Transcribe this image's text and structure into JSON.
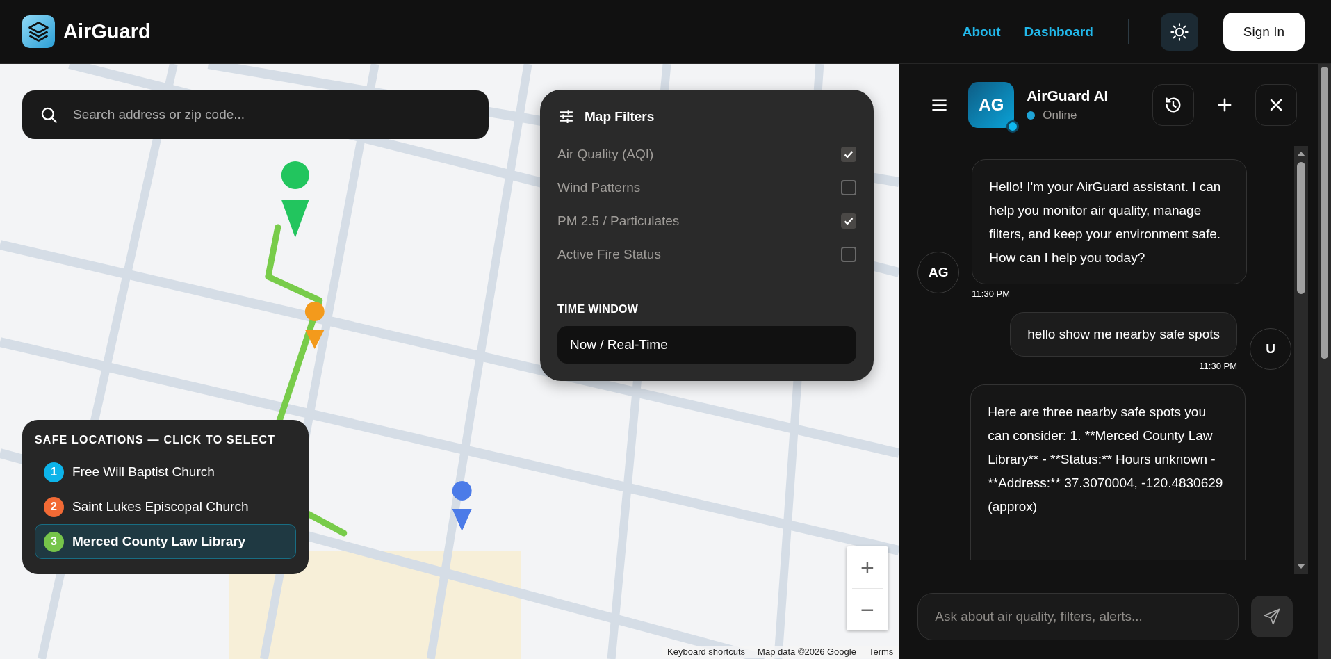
{
  "header": {
    "brand": "AirGuard",
    "nav": [
      {
        "label": "About"
      },
      {
        "label": "Dashboard"
      }
    ],
    "sign_in": "Sign In"
  },
  "map": {
    "search": {
      "placeholder": "Search address or zip code..."
    },
    "filters": {
      "title": "Map Filters",
      "items": [
        {
          "label": "Air Quality (AQI)",
          "checked": true
        },
        {
          "label": "Wind Patterns",
          "checked": false
        },
        {
          "label": "PM 2.5 / Particulates",
          "checked": true
        },
        {
          "label": "Active Fire Status",
          "checked": false
        }
      ],
      "time_window": {
        "label": "TIME WINDOW",
        "value": "Now / Real-Time"
      }
    },
    "safe_locations": {
      "title": "SAFE LOCATIONS — CLICK TO SELECT",
      "items": [
        {
          "number": "1",
          "name": "Free Will Baptist Church",
          "color": "#0db4ea",
          "selected": false
        },
        {
          "number": "2",
          "name": "Saint Lukes Episcopal Church",
          "color": "#f26a35",
          "selected": false
        },
        {
          "number": "3",
          "name": "Merced County Law Library",
          "color": "#76c44a",
          "selected": true
        }
      ]
    },
    "zoom": {
      "in": "+",
      "out": "−"
    },
    "attribution": [
      "Keyboard shortcuts",
      "Map data ©2026 Google",
      "Terms"
    ]
  },
  "chat": {
    "avatar": "AG",
    "title": "AirGuard AI",
    "status": "Online",
    "messages": [
      {
        "kind": "assistant",
        "avatar": "AG",
        "text": "Hello! I'm your AirGuard assistant. I can help you monitor air quality, manage filters, and keep your environment safe. How can I help you today?",
        "time": "11:30 PM"
      },
      {
        "kind": "user",
        "avatar": "U",
        "text": "hello show me nearby safe spots",
        "time": "11:30 PM"
      },
      {
        "kind": "assistant",
        "text": "Here are three nearby safe spots you can consider: 1. **Merced County Law Library** - **Status:** Hours unknown - **Address:** 37.3070004, -120.4830629 (approx)"
      }
    ],
    "input": {
      "placeholder": "Ask about air quality, filters, alerts..."
    }
  }
}
